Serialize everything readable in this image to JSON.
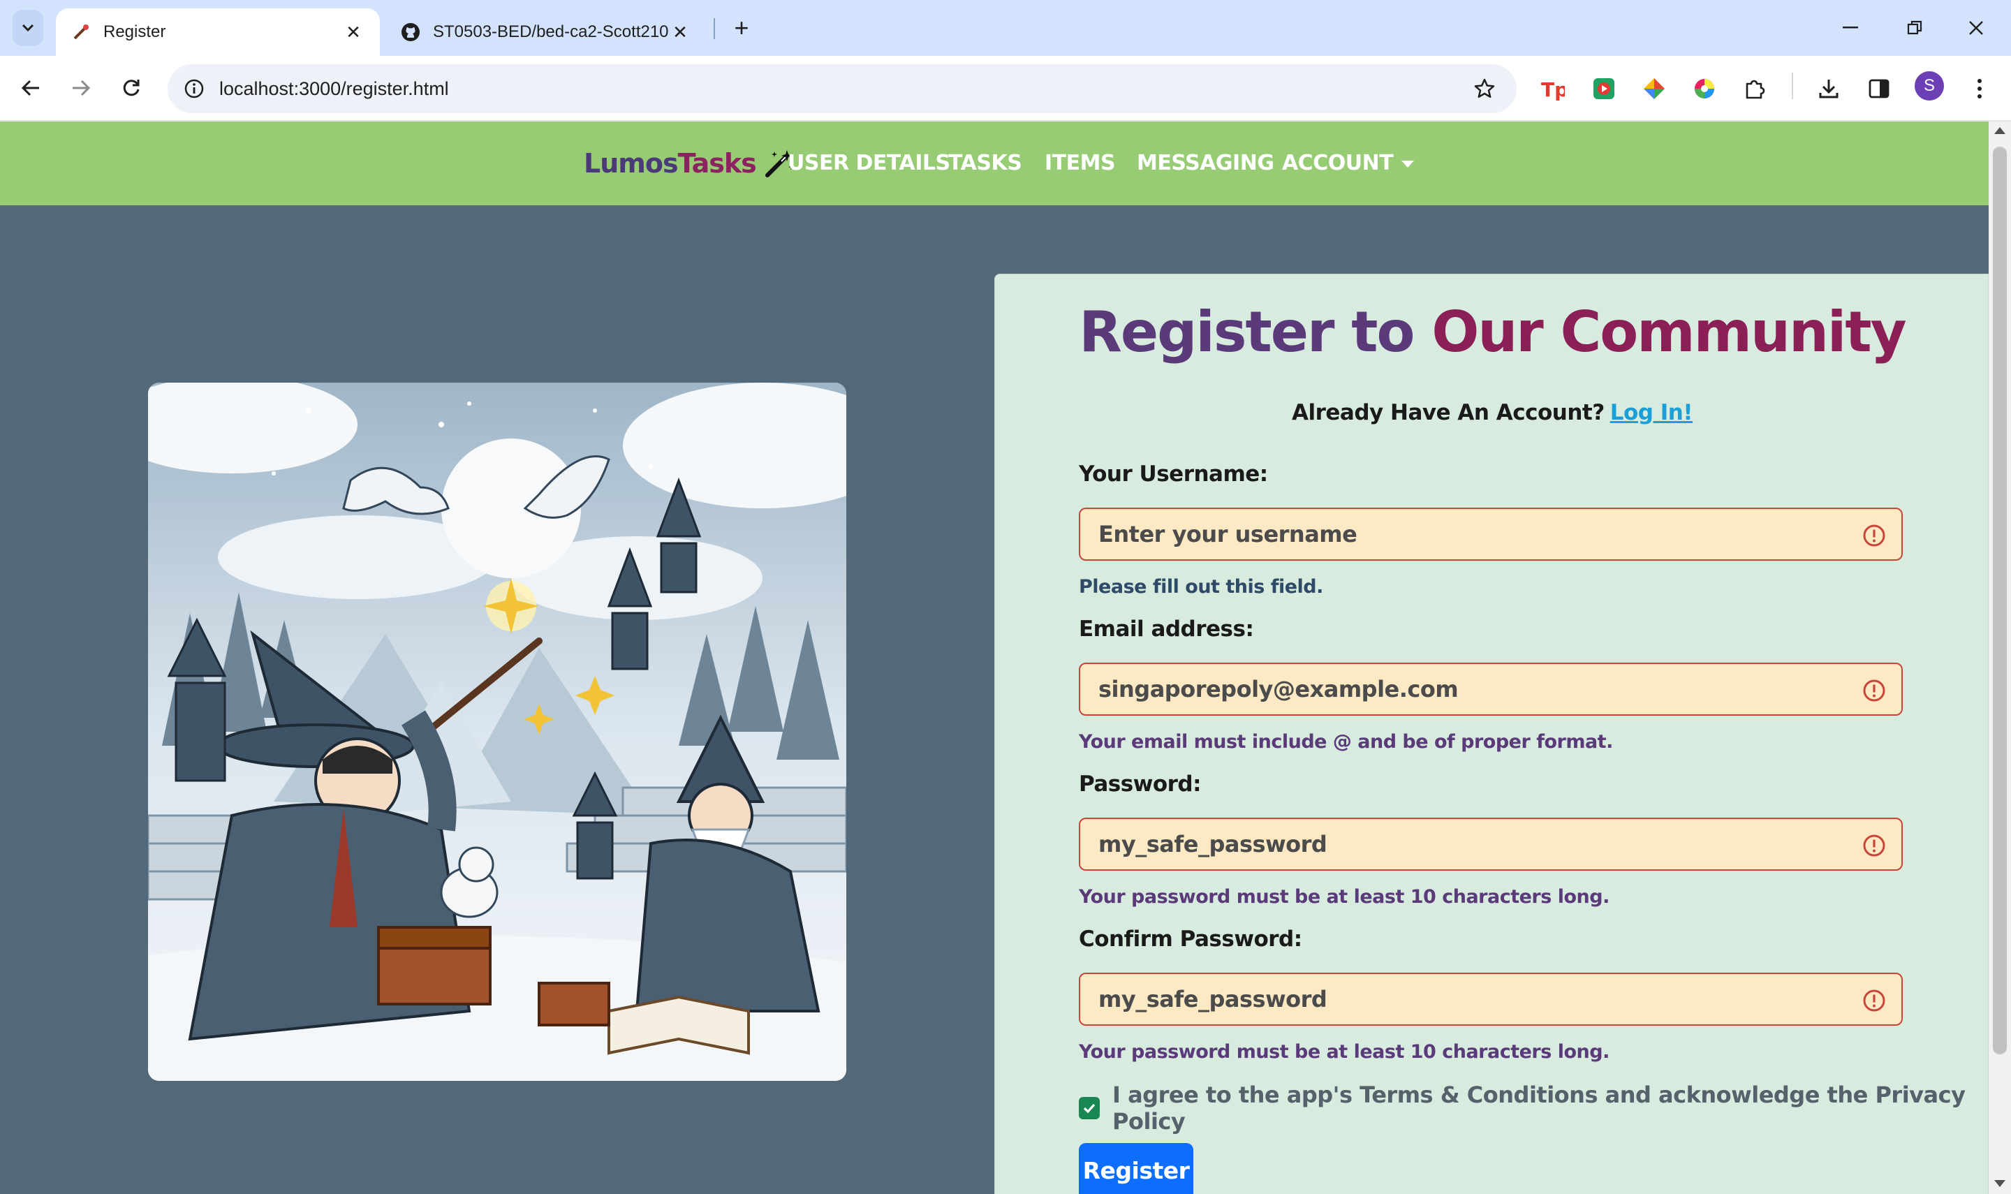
{
  "browser": {
    "tabs": [
      {
        "title": "Register",
        "active": true
      },
      {
        "title": "ST0503-BED/bed-ca2-Scott210",
        "active": false
      }
    ],
    "url": "localhost:3000/register.html",
    "profile_initial": "S"
  },
  "navbar": {
    "brand_part1": "Lumos",
    "brand_part2": "Tasks",
    "links": [
      "USER DETAILS",
      "TASKS",
      "ITEMS",
      "MESSAGING",
      "ACCOUNT"
    ]
  },
  "form": {
    "title_part1": "Register to ",
    "title_part2": "Our Community",
    "login_prompt": "Already Have An Account?",
    "login_link": "Log In!",
    "username": {
      "label": "Your Username:",
      "placeholder": "Enter your username",
      "value": "",
      "help": "Please fill out this field."
    },
    "email": {
      "label": "Email address:",
      "placeholder": "singaporepoly@example.com",
      "help": "Your email must include @ and be of proper format."
    },
    "password": {
      "label": "Password:",
      "placeholder": "my_safe_password",
      "help": "Your password must be at least 10 characters long."
    },
    "confirm_password": {
      "label": "Confirm Password:",
      "placeholder": "my_safe_password",
      "help": "Your password must be at least 10 characters long."
    },
    "agree_text": "I agree to the app's Terms & Conditions and acknowledge the Privacy Policy",
    "agree_checked": true,
    "submit_label": "Register"
  },
  "colors": {
    "navbar_bg": "#97cc74",
    "page_bg": "#536878",
    "card_bg": "#d7ebdf",
    "input_bg": "#fde9c4",
    "error_border": "#c8453a",
    "button_bg": "#0d6efd"
  }
}
